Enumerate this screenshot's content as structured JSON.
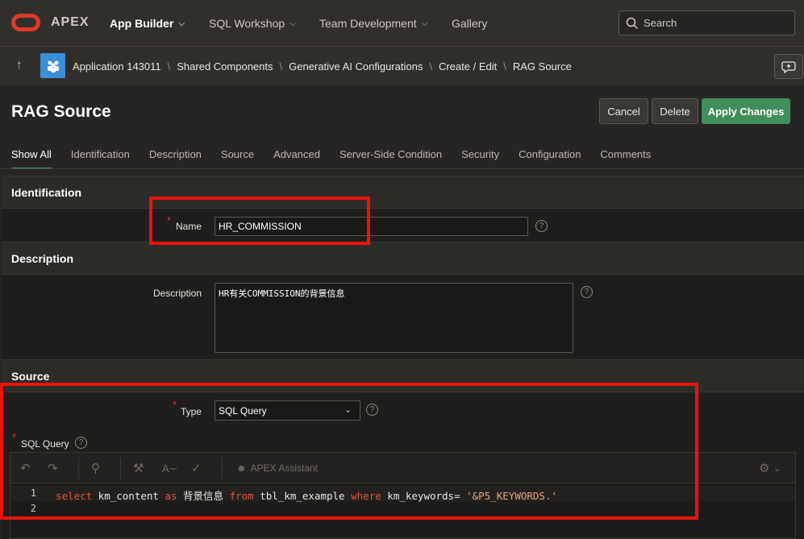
{
  "topnav": {
    "brand": "APEX",
    "items": [
      {
        "label": "App Builder",
        "has_menu": true
      },
      {
        "label": "SQL Workshop",
        "has_menu": true
      },
      {
        "label": "Team Development",
        "has_menu": true
      },
      {
        "label": "Gallery",
        "has_menu": false
      }
    ],
    "search_placeholder": "Search"
  },
  "breadcrumb": {
    "items": [
      "Application 143011",
      "Shared Components",
      "Generative AI Configurations",
      "Create / Edit",
      "RAG Source"
    ]
  },
  "page": {
    "title": "RAG Source",
    "buttons": {
      "cancel": "Cancel",
      "delete": "Delete",
      "apply": "Apply Changes"
    }
  },
  "tabs": [
    "Show All",
    "Identification",
    "Description",
    "Source",
    "Advanced",
    "Server-Side Condition",
    "Security",
    "Configuration",
    "Comments"
  ],
  "sections": {
    "identification": {
      "title": "Identification",
      "name_label": "Name",
      "name_value": "HR_COMMISSION"
    },
    "description": {
      "title": "Description",
      "description_label": "Description",
      "description_value": "HR有关COMMISSION的背景信息"
    },
    "source": {
      "title": "Source",
      "type_label": "Type",
      "type_value": "SQL Query",
      "sql_label": "SQL Query",
      "assistant_label": "APEX Assistant",
      "code_lines": [
        {
          "num": "1"
        },
        {
          "num": "2"
        }
      ],
      "code_tokens": {
        "select": "select",
        "col": " km_content ",
        "as": "as",
        "alias": " 背景信息 ",
        "from": "from",
        "table": " tbl_km_example ",
        "where": "where",
        "cond": " km_keywords= ",
        "value": "'&P5_KEYWORDS.'"
      }
    }
  },
  "colors": {
    "primary_button": "#3f8e5b",
    "highlight": "#e8130c",
    "required": "#e0382c",
    "sql_keyword": "#e0553c"
  }
}
